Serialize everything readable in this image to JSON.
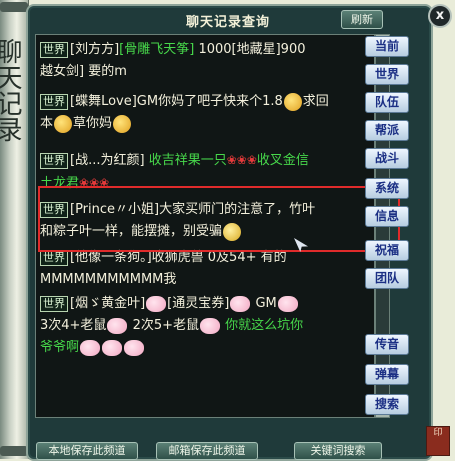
{
  "window": {
    "title": "聊天记录查询",
    "refresh_label": "刷新",
    "close_label": "x",
    "scroll_text": "聊天记录"
  },
  "messages": [
    {
      "channel": "世界",
      "name": "[刘方方]",
      "text": "[骨雕飞天筝]",
      "text2": "1000[地藏星]900",
      "line2": "越女剑] 要的m"
    },
    {
      "channel": "世界",
      "name": "[蝶舞Love]GM你妈了吧子快来个1.8",
      "text": "求回",
      "line2": "本",
      "line2b": "草你妈"
    },
    {
      "channel": "世界",
      "name": "[战...为红颜]",
      "text": "收吉祥果一只",
      "text2": "收叉金信",
      "line2": "土龙君"
    },
    {
      "channel": "世界",
      "name": "[Prince〃小姐]大家买师门的注意了，竹叶",
      "line2": "和粽子叶一样，能摆摊，别受骗"
    },
    {
      "channel": "世界",
      "name": "[他像一条狗。]收狮虎兽 0及54+ 有的",
      "line2": "MMMMMMMMMMM我"
    },
    {
      "channel": "世界",
      "name": "[烟ゞ黄金叶]",
      "text": "[通灵宝券]",
      "text2": "GM",
      "line2": "3次4+老鼠",
      "line2b": "2次5+老鼠",
      "line2c": "你就这么坑你",
      "line3": "爷爷啊"
    }
  ],
  "side_buttons": [
    "当前",
    "世界",
    "队伍",
    "帮派",
    "战斗",
    "系统",
    "信息",
    "祝福",
    "团队",
    "传音",
    "弹幕",
    "搜索"
  ],
  "bottom_buttons": [
    "本地保存此频道",
    "邮箱保存此频道",
    "关键词搜索"
  ],
  "seal_text": "印",
  "colors": {
    "frame": "#1f3a3a",
    "highlight": "#e02b2b",
    "green_text": "#47d84b",
    "button_text": "#1b2f84"
  }
}
